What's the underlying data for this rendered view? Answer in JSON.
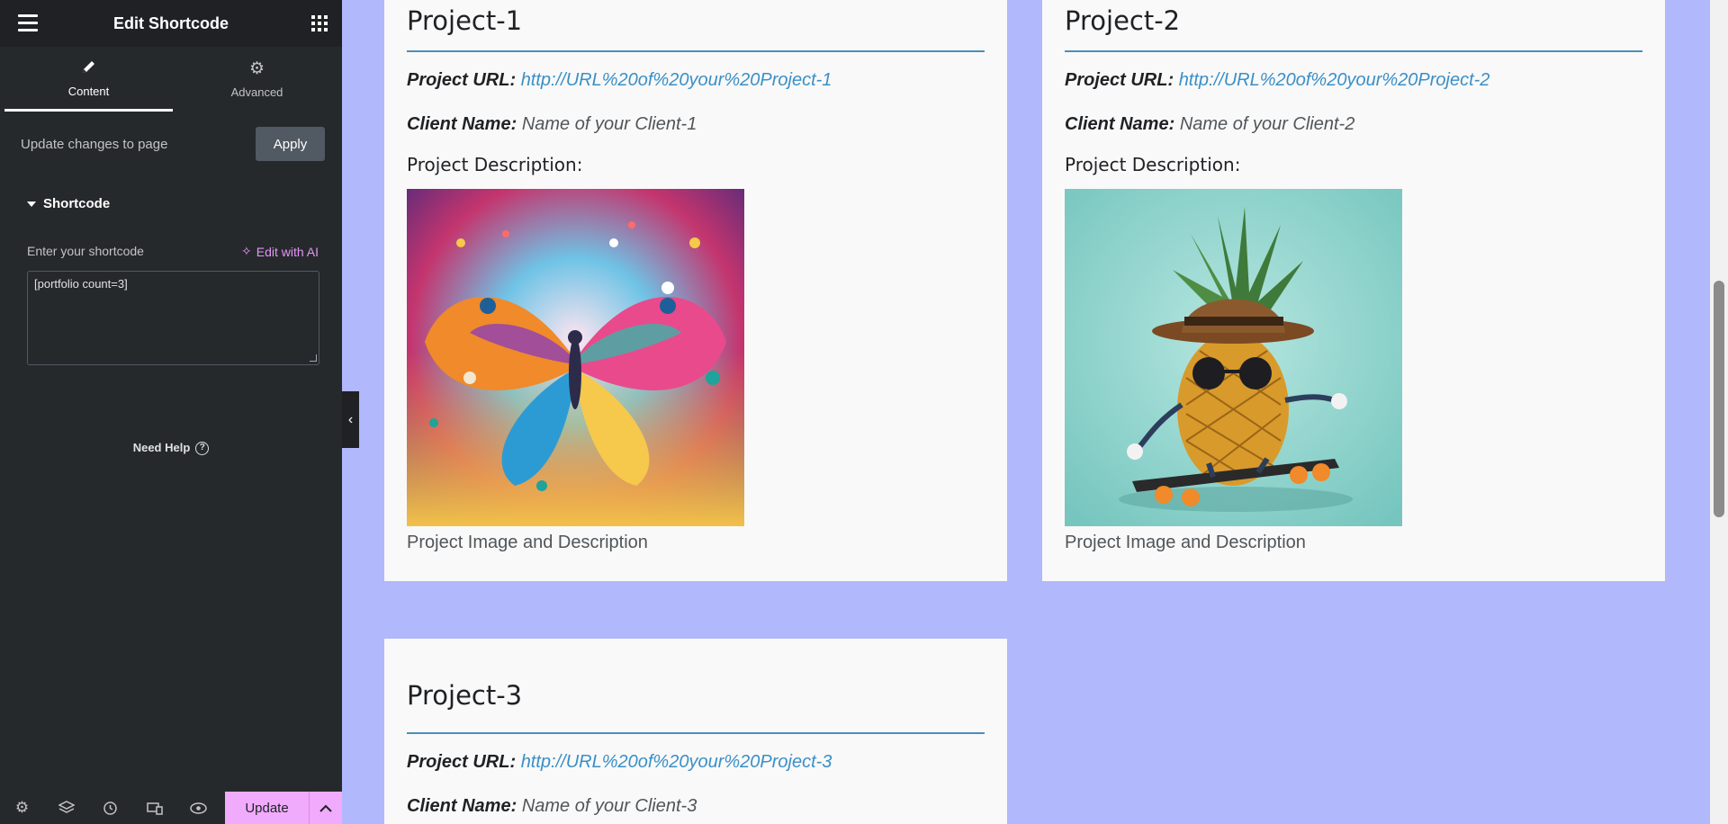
{
  "panel": {
    "title": "Edit Shortcode",
    "tabs": [
      {
        "label": "Content",
        "icon": "pencil-icon"
      },
      {
        "label": "Advanced",
        "icon": "gear-icon"
      }
    ],
    "update_changes_text": "Update changes to page",
    "apply_label": "Apply",
    "section_title": "Shortcode",
    "shortcode_label": "Enter your shortcode",
    "edit_ai_label": "Edit with AI",
    "shortcode_value": "[portfolio count=3]",
    "need_help_label": "Need Help",
    "bottom_icons": [
      "settings-icon",
      "layers-icon",
      "history-icon",
      "responsive-icon",
      "preview-icon"
    ],
    "update_label": "Update"
  },
  "preview": {
    "projects": [
      {
        "title": "Project-1",
        "url_label": "Project URL:",
        "url": "http://URL%20of%20your%20Project-1",
        "client_label": "Client Name:",
        "client": "Name of your Client-1",
        "desc_label": "Project Description:",
        "caption": "Project Image and Description"
      },
      {
        "title": "Project-2",
        "url_label": "Project URL:",
        "url": "http://URL%20of%20your%20Project-2",
        "client_label": "Client Name:",
        "client": "Name of your Client-2",
        "desc_label": "Project Description:",
        "caption": "Project Image and Description"
      },
      {
        "title": "Project-3",
        "url_label": "Project URL:",
        "url": "http://URL%20of%20your%20Project-3",
        "client_label": "Client Name:",
        "client": "Name of your Client-3"
      }
    ]
  },
  "colors": {
    "panel_bg": "#26292c",
    "accent_pink": "#f0abfc",
    "preview_bg": "#b1b8fb",
    "link": "#3a8fc7"
  }
}
